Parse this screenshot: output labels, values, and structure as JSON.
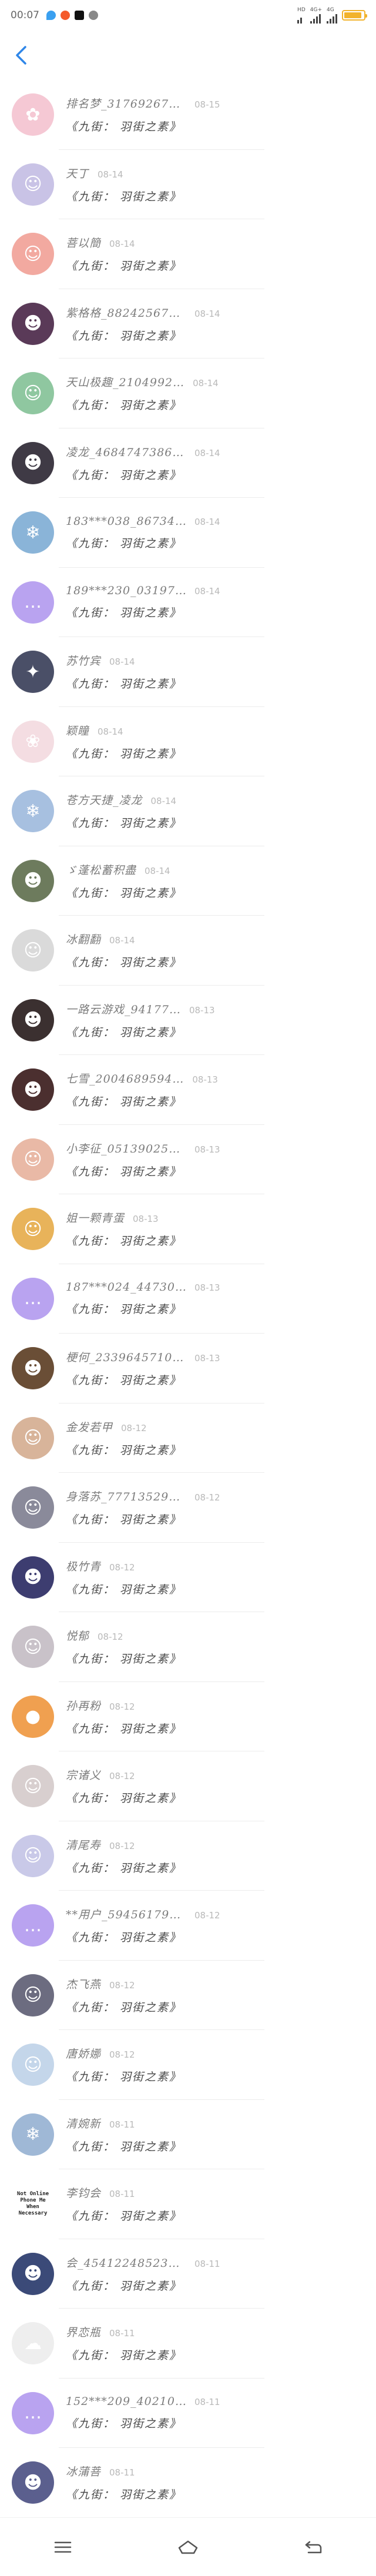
{
  "status_bar": {
    "time": "00:07",
    "net_a_label": "HD",
    "net_b_label": "4G+",
    "net_c_label": "4G",
    "battery_level": 0.9,
    "colors": {
      "app1": "#3aa0f0",
      "app2": "#f45a2a",
      "app3": "#111111",
      "app4": "#888888",
      "battery": "#f2b32c"
    }
  },
  "header": {
    "back_icon": "chevron-left-icon",
    "accent": "#2f86e8"
  },
  "message_template": "《九街： 羽街之素》",
  "list": [
    {
      "name": "排名梦_3176926737…",
      "date": "08-15",
      "avatar_color": "#f5c8d4",
      "avatar_glyph": "✿",
      "message": "《九街： 羽街之素》"
    },
    {
      "name": "天丁",
      "date": "08-14",
      "avatar_color": "#c9c3e6",
      "avatar_glyph": "☺",
      "message": "《九街： 羽街之素》"
    },
    {
      "name": "菩以簡",
      "date": "08-14",
      "avatar_color": "#f2a9a0",
      "avatar_glyph": "☺",
      "message": "《九街： 羽街之素》"
    },
    {
      "name": "紫格格_882425671…",
      "date": "08-14",
      "avatar_color": "#5a3a58",
      "avatar_glyph": "☻",
      "message": "《九街： 羽街之素》"
    },
    {
      "name": "天山极趣_2104992…",
      "date": "08-14",
      "avatar_color": "#8fc7a0",
      "avatar_glyph": "☺",
      "message": "《九街： 羽街之素》"
    },
    {
      "name": "凌龙_46847473867…",
      "date": "08-14",
      "avatar_color": "#3f3a45",
      "avatar_glyph": "☻",
      "message": "《九街： 羽街之素》"
    },
    {
      "name": "183***038_8673425488",
      "date": "08-14",
      "avatar_color": "#8ab4d8",
      "avatar_glyph": "❄",
      "message": "《九街： 羽街之素》"
    },
    {
      "name": "189***230_03197058",
      "date": "08-14",
      "avatar_color": "#b9a3f0",
      "avatar_glyph": "…",
      "message": "《九街： 羽街之素》"
    },
    {
      "name": "苏竹宾",
      "date": "08-14",
      "avatar_color": "#4a4f67",
      "avatar_glyph": "✦",
      "message": "《九街： 羽街之素》"
    },
    {
      "name": "颖瞳",
      "date": "08-14",
      "avatar_color": "#f4dde2",
      "avatar_glyph": "❀",
      "message": "《九街： 羽街之素》"
    },
    {
      "name": "苍方天捷_凌龙",
      "date": "08-14",
      "avatar_color": "#a7c0e0",
      "avatar_glyph": "❄",
      "message": "《九街： 羽街之素》"
    },
    {
      "name": "ゞ蓬松蓄积盡",
      "date": "08-14",
      "avatar_color": "#6d7b5d",
      "avatar_glyph": "☻",
      "message": "《九街： 羽街之素》"
    },
    {
      "name": "冰翻翻",
      "date": "08-14",
      "avatar_color": "#dadada",
      "avatar_glyph": "☺",
      "message": "《九街： 羽街之素》"
    },
    {
      "name": "一路云游戏_94177…",
      "date": "08-13",
      "avatar_color": "#3b3030",
      "avatar_glyph": "☻",
      "message": "《九街： 羽街之素》"
    },
    {
      "name": "七雪_2004689594…",
      "date": "08-13",
      "avatar_color": "#4b2f2f",
      "avatar_glyph": "☻",
      "message": "《九街： 羽街之素》"
    },
    {
      "name": "小李征_0513902507…",
      "date": "08-13",
      "avatar_color": "#e9b9a6",
      "avatar_glyph": "☺",
      "message": "《九街： 羽街之素》"
    },
    {
      "name": "姐一颗青蛋",
      "date": "08-13",
      "avatar_color": "#e8b35a",
      "avatar_glyph": "☺",
      "message": "《九街： 羽街之素》"
    },
    {
      "name": "187***024_4473050080",
      "date": "08-13",
      "avatar_color": "#b9a3f0",
      "avatar_glyph": "…",
      "message": "《九街： 羽街之素》"
    },
    {
      "name": "梗何_23396457107…",
      "date": "08-13",
      "avatar_color": "#6a4e36",
      "avatar_glyph": "☻",
      "message": "《九街： 羽街之素》"
    },
    {
      "name": "金发若甲",
      "date": "08-12",
      "avatar_color": "#d8b49a",
      "avatar_glyph": "☺",
      "message": "《九街： 羽街之素》"
    },
    {
      "name": "身落苏_7771352936…",
      "date": "08-12",
      "avatar_color": "#8a8a9a",
      "avatar_glyph": "☺",
      "message": "《九街： 羽街之素》"
    },
    {
      "name": "极竹青",
      "date": "08-12",
      "avatar_color": "#3d3d70",
      "avatar_glyph": "☻",
      "message": "《九街： 羽街之素》"
    },
    {
      "name": "悦郁",
      "date": "08-12",
      "avatar_color": "#c9c2c9",
      "avatar_glyph": "☺",
      "message": "《九街： 羽街之素》"
    },
    {
      "name": "孙再粉",
      "date": "08-12",
      "avatar_color": "#f0a050",
      "avatar_glyph": "●",
      "message": "《九街： 羽街之素》"
    },
    {
      "name": "宗诸义",
      "date": "08-12",
      "avatar_color": "#d8cfcf",
      "avatar_glyph": "☺",
      "message": "《九街： 羽街之素》"
    },
    {
      "name": "清尾寿",
      "date": "08-12",
      "avatar_color": "#c9c9e8",
      "avatar_glyph": "☺",
      "message": "《九街： 羽街之素》"
    },
    {
      "name": "**用户_5945617964…",
      "date": "08-12",
      "avatar_color": "#b9a3f0",
      "avatar_glyph": "…",
      "message": "《九街： 羽街之素》"
    },
    {
      "name": "杰飞燕",
      "date": "08-12",
      "avatar_color": "#6c6c80",
      "avatar_glyph": "☺",
      "message": "《九街： 羽街之素》"
    },
    {
      "name": "唐娇娜",
      "date": "08-12",
      "avatar_color": "#c4d6ea",
      "avatar_glyph": "☺",
      "message": "《九街： 羽街之素》"
    },
    {
      "name": "清婉新",
      "date": "08-11",
      "avatar_color": "#9fb8d6",
      "avatar_glyph": "❄",
      "message": "《九街： 羽街之素》"
    },
    {
      "name": "李钧会",
      "date": "08-11",
      "avatar_color": "#ffffff",
      "avatar_text": "Not Online\nPhone Me\nWhen\nNecessary",
      "message": "《九街： 羽街之素》"
    },
    {
      "name": "会_4541224852364…",
      "date": "08-11",
      "avatar_color": "#3b4a78",
      "avatar_glyph": "☻",
      "message": "《九街： 羽街之素》"
    },
    {
      "name": "界恋瓶",
      "date": "08-11",
      "avatar_color": "#eeeeee",
      "avatar_glyph": "☁",
      "message": "《九街： 羽街之素》"
    },
    {
      "name": "152***209_4021013963",
      "date": "08-11",
      "avatar_color": "#b9a3f0",
      "avatar_glyph": "…",
      "message": "《九街： 羽街之素》"
    },
    {
      "name": "冰蒲菩",
      "date": "08-11",
      "avatar_color": "#5b5f8e",
      "avatar_glyph": "☻",
      "message": "《九街： 羽街之素》"
    }
  ],
  "bottom_nav": [
    {
      "name": "menu-icon"
    },
    {
      "name": "home-icon"
    },
    {
      "name": "back-icon"
    }
  ]
}
